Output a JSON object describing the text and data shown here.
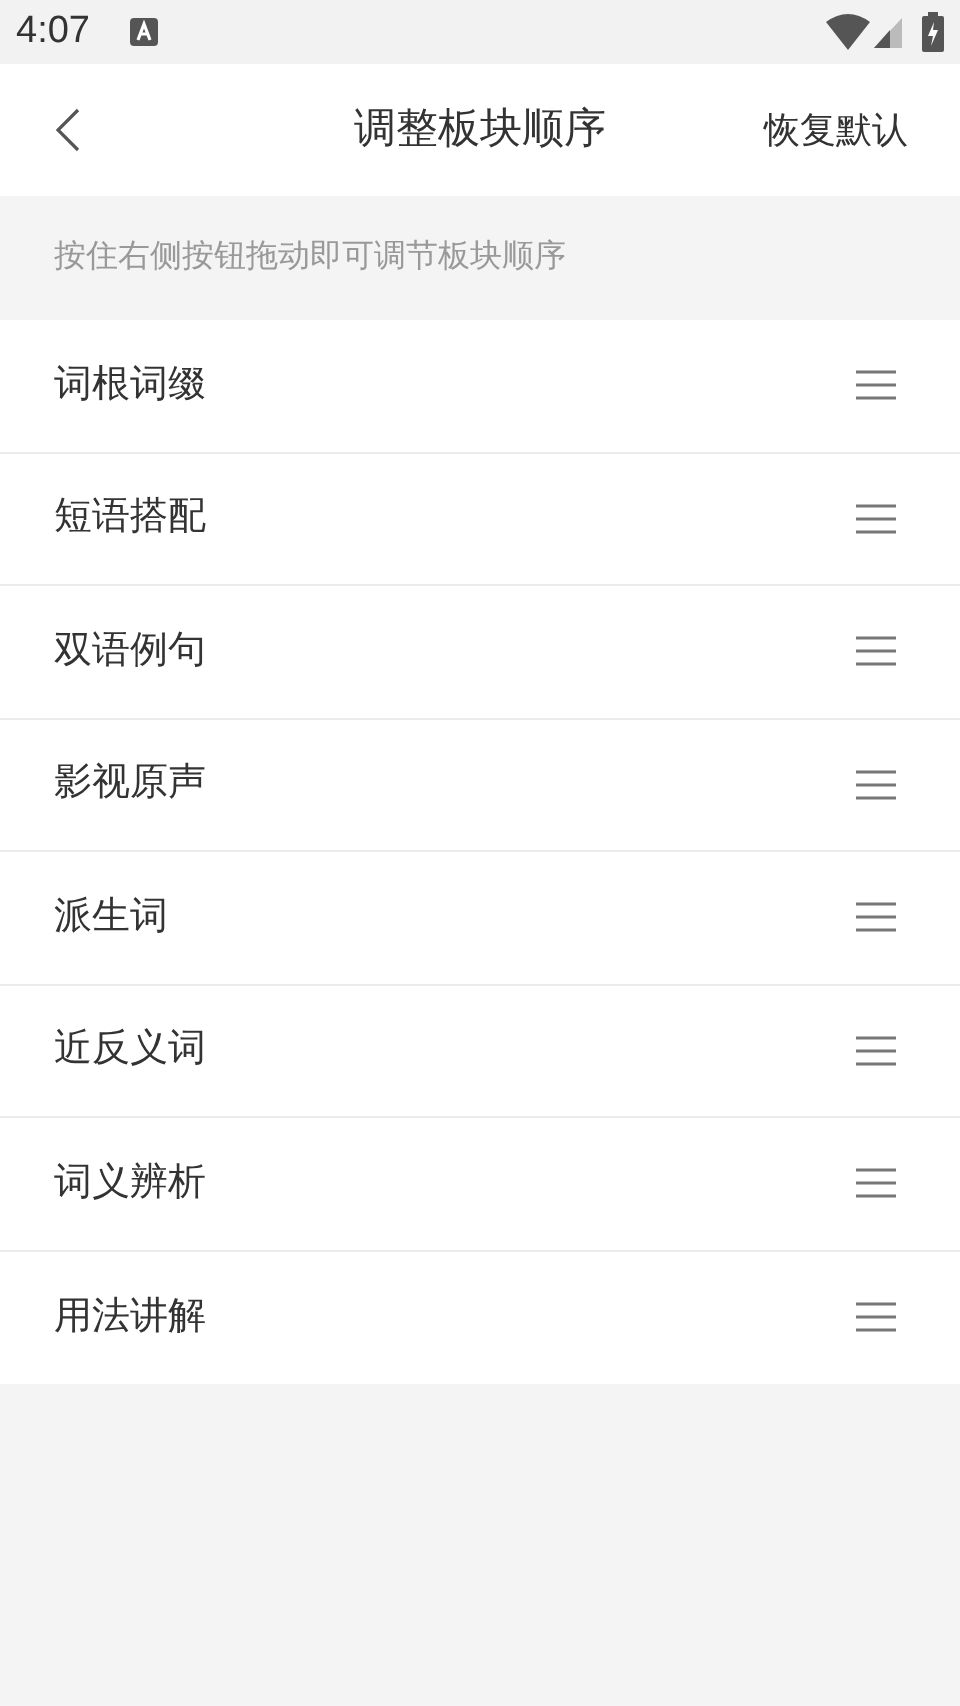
{
  "status_bar": {
    "time": "4:07"
  },
  "header": {
    "title": "调整板块顺序",
    "action": "恢复默认"
  },
  "hint": "按住右侧按钮拖动即可调节板块顺序",
  "sections": [
    {
      "label": "词根词缀"
    },
    {
      "label": "短语搭配"
    },
    {
      "label": "双语例句"
    },
    {
      "label": "影视原声"
    },
    {
      "label": "派生词"
    },
    {
      "label": "近反义词"
    },
    {
      "label": "词义辨析"
    },
    {
      "label": "用法讲解"
    }
  ]
}
